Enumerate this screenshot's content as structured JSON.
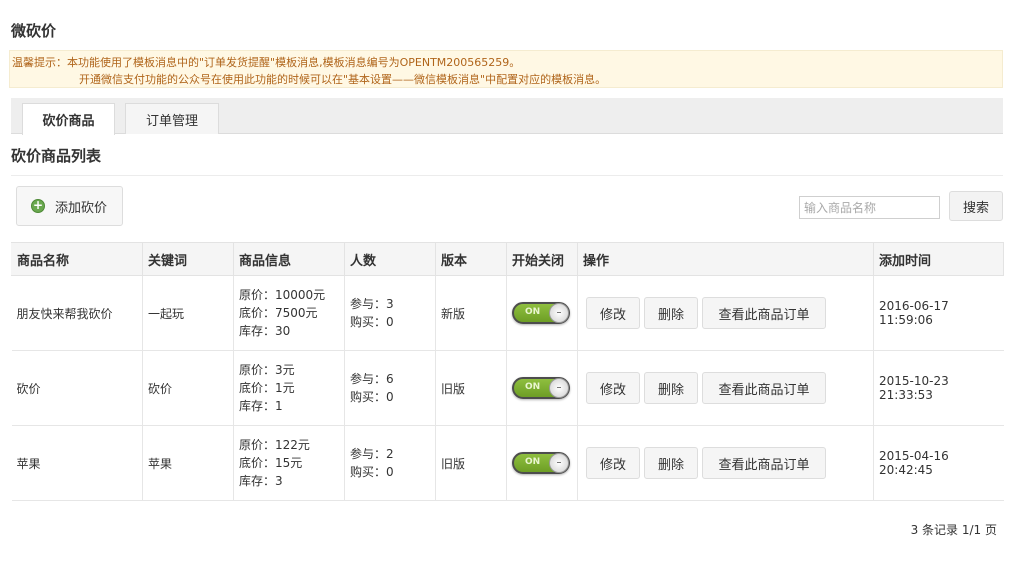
{
  "page": {
    "title": "微砍价"
  },
  "tip": {
    "line1": "温馨提示：本功能使用了模板消息中的\"订单发货提醒\"模板消息,模板消息编号为OPENTM200565259。",
    "line2": "开通微信支付功能的公众号在使用此功能的时候可以在\"基本设置——微信模板消息\"中配置对应的模板消息。"
  },
  "tabs": [
    {
      "label": "砍价商品",
      "active": true
    },
    {
      "label": "订单管理",
      "active": false
    }
  ],
  "section": {
    "title": "砍价商品列表"
  },
  "toolbar": {
    "add_label": "添加砍价",
    "search_placeholder": "输入商品名称",
    "search_label": "搜索"
  },
  "table": {
    "headers": [
      "商品名称",
      "关键词",
      "商品信息",
      "人数",
      "版本",
      "开始关闭",
      "操作",
      "添加时间"
    ],
    "rows": [
      {
        "name": "朋友快来帮我砍价",
        "keyword": "一起玩",
        "info": [
          "原价：10000元",
          "底价：7500元",
          "库存：30"
        ],
        "people": [
          "参与：3",
          "购买：0"
        ],
        "version": "新版",
        "toggle": "ON",
        "ops": [
          "修改",
          "删除",
          "查看此商品订单"
        ],
        "time": "2016-06-17 11:59:06"
      },
      {
        "name": "砍价",
        "keyword": "砍价",
        "info": [
          "原价：3元",
          "底价：1元",
          "库存：1"
        ],
        "people": [
          "参与：6",
          "购买：0"
        ],
        "version": "旧版",
        "toggle": "ON",
        "ops": [
          "修改",
          "删除",
          "查看此商品订单"
        ],
        "time": "2015-10-23 21:33:53"
      },
      {
        "name": "苹果",
        "keyword": "苹果",
        "info": [
          "原价：122元",
          "底价：15元",
          "库存：3"
        ],
        "people": [
          "参与：2",
          "购买：0"
        ],
        "version": "旧版",
        "toggle": "ON",
        "ops": [
          "修改",
          "删除",
          "查看此商品订单"
        ],
        "time": "2015-04-16 20:42:45"
      }
    ]
  },
  "pager": {
    "text": "3 条记录 1/1 页"
  },
  "colors": {
    "tip_text": "#b0651b",
    "tip_bg": "#fff8e4",
    "version_new": "#2e7d32",
    "version_old": "#1565c0",
    "toggle_on": "#7fb032"
  }
}
